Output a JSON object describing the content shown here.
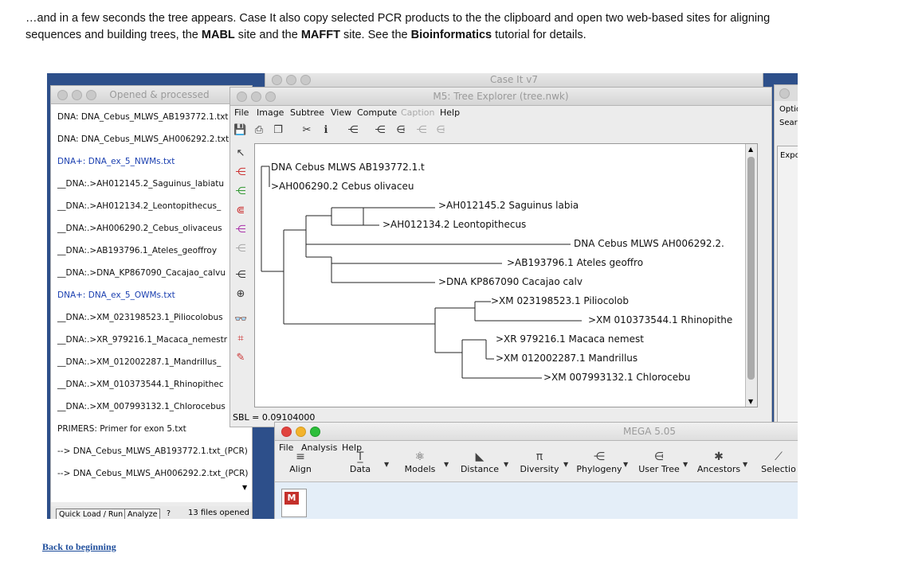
{
  "slide": {
    "line1": "…and in a few seconds the tree appears.  Case It also copy selected PCR products to the the clipboard and open two web-based sites for aligning",
    "line2_a": "sequences and building trees, the ",
    "line2_mabl": "MABL",
    "line2_b": " site and the ",
    "line2_mafft": "MAFFT",
    "line2_c": " site.  See the ",
    "line2_bio": "Bioinformatics",
    "line2_d": " tutorial for details.",
    "back_link": "Back to beginning"
  },
  "caseit": {
    "title": "Case It v7"
  },
  "opened": {
    "title": "Opened & processed",
    "items": [
      {
        "label": "DNA: DNA_Cebus_MLWS_AB193772.1.txt",
        "color": "#111111"
      },
      {
        "label": "DNA: DNA_Cebus_MLWS_AH006292.2.txt",
        "color": "#111111"
      },
      {
        "label": "DNA+: DNA_ex_5_NWMs.txt",
        "color": "#1a3fb0"
      },
      {
        "label": "__DNA:.>AH012145.2_Saguinus_labiatu",
        "color": "#111111"
      },
      {
        "label": "__DNA:.>AH012134.2_Leontopithecus_",
        "color": "#111111"
      },
      {
        "label": "__DNA:.>AH006290.2_Cebus_olivaceus",
        "color": "#111111"
      },
      {
        "label": "__DNA:.>AB193796.1_Ateles_geoffroy",
        "color": "#111111"
      },
      {
        "label": "__DNA:.>DNA_KP867090_Cacajao_calvu",
        "color": "#111111"
      },
      {
        "label": "DNA+: DNA_ex_5_OWMs.txt",
        "color": "#1a3fb0"
      },
      {
        "label": "__DNA:.>XM_023198523.1_Piliocolobus",
        "color": "#111111"
      },
      {
        "label": "__DNA:.>XR_979216.1_Macaca_nemestr",
        "color": "#111111"
      },
      {
        "label": "__DNA:.>XM_012002287.1_Mandrillus_",
        "color": "#111111"
      },
      {
        "label": "__DNA:.>XM_010373544.1_Rhinopithec",
        "color": "#111111"
      },
      {
        "label": "__DNA:.>XM_007993132.1_Chlorocebus",
        "color": "#111111"
      },
      {
        "label": "PRIMERS: Primer for exon 5.txt",
        "color": "#111111"
      },
      {
        "label": "--> DNA_Cebus_MLWS_AB193772.1.txt_(PCR)",
        "color": "#111111"
      },
      {
        "label": "--> DNA_Cebus_MLWS_AH006292.2.txt_(PCR)",
        "color": "#111111"
      }
    ],
    "quick_load": "Quick Load / Run",
    "analyze": "Analyze",
    "help": "?",
    "files_opened": "13 files opened"
  },
  "tree_explorer": {
    "title": "M5: Tree Explorer (tree.nwk)",
    "menu": [
      "File",
      "Image",
      "Subtree",
      "View",
      "Compute",
      "Caption",
      "Help"
    ],
    "sbl": "SBL = 0.09104000",
    "leaves": [
      "DNA Cebus MLWS AB193772.1.t",
      ">AH006290.2 Cebus olivaceu",
      ">AH012145.2 Saguinus labia",
      ">AH012134.2 Leontopithecus",
      "DNA Cebus MLWS AH006292.2.",
      ">AB193796.1 Ateles geoffro",
      ">DNA KP867090 Cacajao calv",
      ">XM 023198523.1 Piliocolob",
      ">XM 010373544.1 Rhinopithe",
      ">XR 979216.1 Macaca nemest",
      ">XM 012002287.1 Mandrillus",
      ">XM 007993132.1 Chlorocebu"
    ]
  },
  "right_window": {
    "opt": "Optio",
    "search": "Sear",
    "expo": "Expo"
  },
  "mega": {
    "title": "MEGA 5.05",
    "menu": [
      "File",
      "Analysis",
      "Help"
    ],
    "buttons": [
      "Align",
      "Data",
      "Models",
      "Distance",
      "Diversity",
      "Phylogeny",
      "User Tree",
      "Ancestors",
      "Selectio"
    ]
  }
}
